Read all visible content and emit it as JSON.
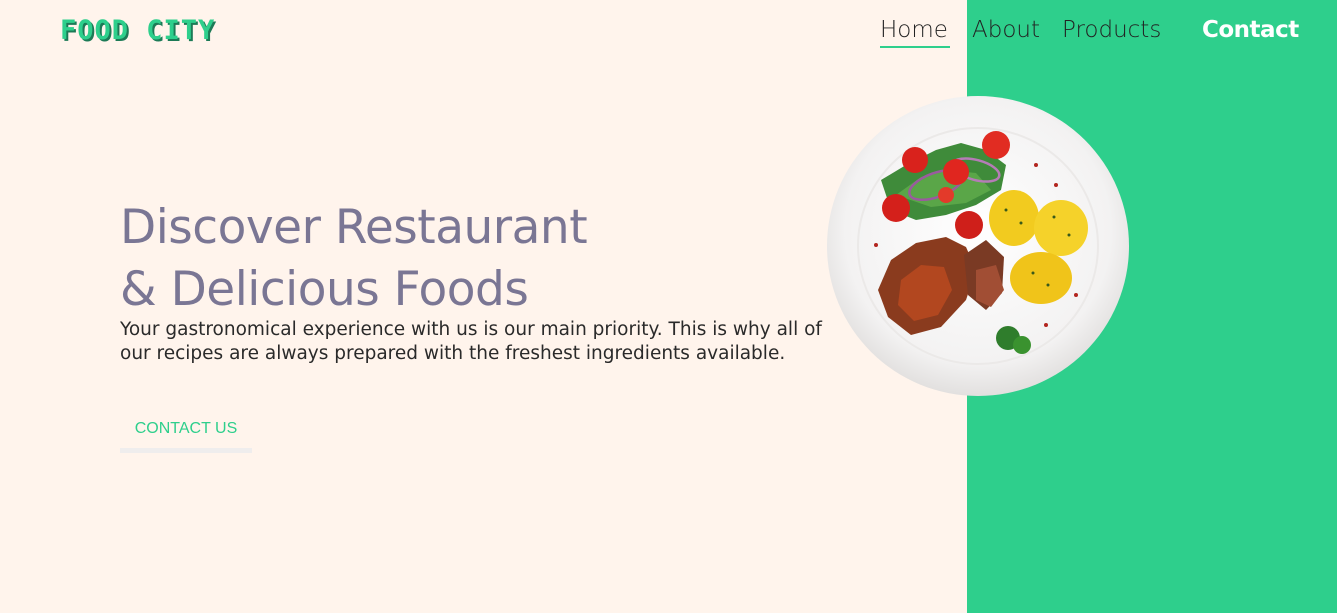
{
  "brand": {
    "logo_text": "FOOD CITY"
  },
  "nav": {
    "home": "Home",
    "about": "About",
    "products": "Products",
    "contact": "Contact"
  },
  "hero": {
    "headline_line1": "Discover Restaurant",
    "headline_line2": "& Delicious Foods",
    "subtitle": "Your gastronomical experience with us is our main priority. This is why all of our recipes are always prepared with the freshest ingredients available.",
    "cta_label": "CONTACT US"
  },
  "colors": {
    "background": "#fff4ec",
    "accent": "#2ecf8c",
    "headline": "#7a7694"
  },
  "images": {
    "hero_plate": "plate-of-grilled-meat-salad-and-potatoes"
  }
}
